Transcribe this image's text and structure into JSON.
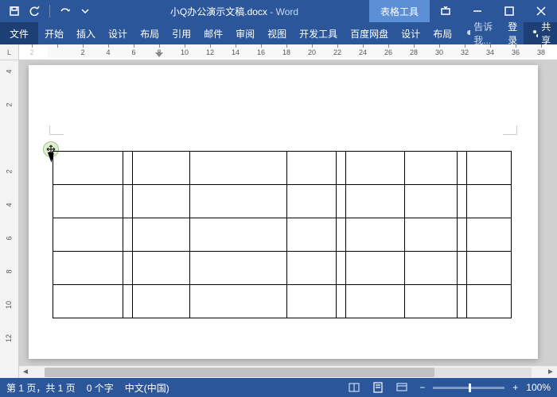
{
  "title": {
    "filename": "小Q办公演示文稿.docx",
    "app": "Word",
    "context_tab": "表格工具"
  },
  "qat": {
    "save": "保存",
    "undo": "撤销",
    "redo": "重做"
  },
  "ribbon": {
    "file": "文件",
    "tabs": [
      "开始",
      "插入",
      "设计",
      "布局",
      "引用",
      "邮件",
      "审阅",
      "视图",
      "开发工具",
      "百度网盘",
      "设计",
      "布局"
    ],
    "tell_me": "告诉我...",
    "login": "登录",
    "share": "共享"
  },
  "ruler_h": {
    "left_label": "L",
    "ticks": [
      "2",
      "",
      "2",
      "4",
      "6",
      "8",
      "10",
      "12",
      "14",
      "16",
      "18",
      "20",
      "22",
      "24",
      "26",
      "28",
      "30",
      "32",
      "34",
      "36",
      "38"
    ]
  },
  "ruler_v": {
    "ticks": [
      "4",
      "2",
      "",
      "2",
      "4",
      "6",
      "8",
      "10",
      "12"
    ]
  },
  "status": {
    "page": "第 1 页，共 1 页",
    "words": "0 个字",
    "lang": "中文(中国)",
    "zoom": "100%"
  }
}
